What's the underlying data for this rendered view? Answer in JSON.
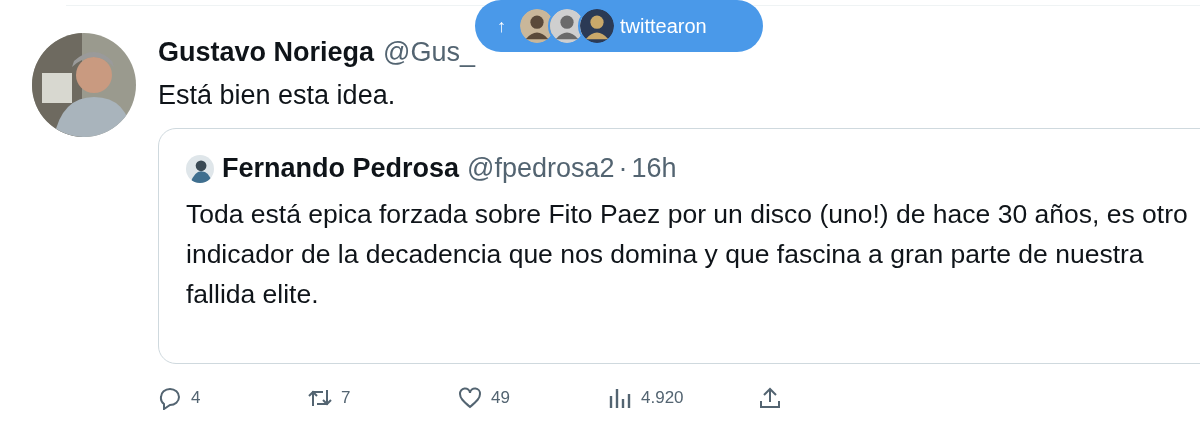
{
  "tweet": {
    "author": "Gustavo Noriega",
    "handle": "@Gus_",
    "text": "Está bien esta idea."
  },
  "banner": {
    "arrow": "↑",
    "label": "twittearon"
  },
  "quote": {
    "author": "Fernando Pedrosa",
    "handle": "@fpedrosa2",
    "separator": "·",
    "time": "16h",
    "text": "Toda está epica forzada sobre Fito Paez por un disco (uno!) de hace 30 años, es otro indicador de la decadencia que nos domina y que fascina a gran parte de nuestra fallida elite."
  },
  "actions": [
    {
      "kind": "reply",
      "count": "4"
    },
    {
      "kind": "retweet",
      "count": "7"
    },
    {
      "kind": "like",
      "count": "49"
    },
    {
      "kind": "views",
      "count": "4.920"
    },
    {
      "kind": "share"
    }
  ]
}
